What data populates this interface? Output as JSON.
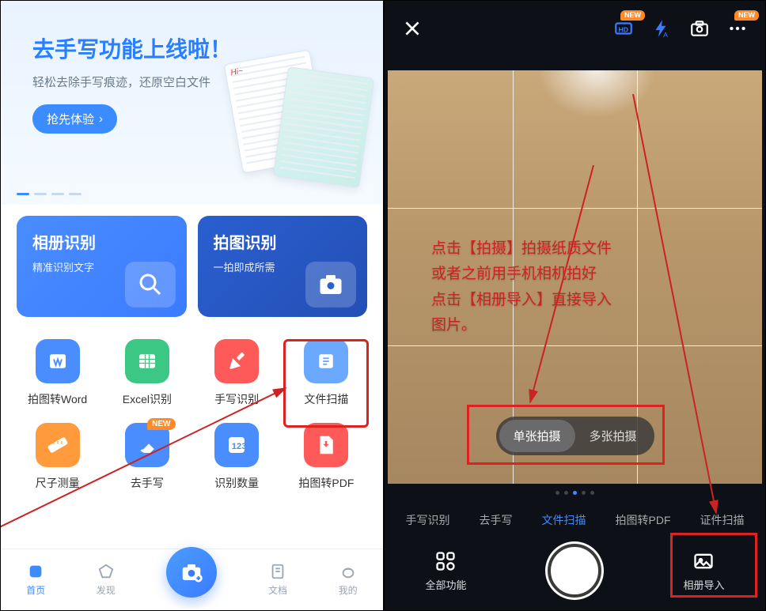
{
  "left": {
    "banner": {
      "title": "去手写功能上线啦！",
      "subtitle": "轻松去除手写痕迹，还原空白文件",
      "cta": "抢先体验"
    },
    "features": [
      {
        "title": "相册识别",
        "subtitle": "精准识别文字"
      },
      {
        "title": "拍图识别",
        "subtitle": "一拍即成所需"
      }
    ],
    "grid": [
      {
        "label": "拍图转Word",
        "icon": "word-icon",
        "color": "ic-blue"
      },
      {
        "label": "Excel识别",
        "icon": "excel-icon",
        "color": "ic-green"
      },
      {
        "label": "手写识别",
        "icon": "handwriting-icon",
        "color": "ic-red"
      },
      {
        "label": "文件扫描",
        "icon": "scan-icon",
        "color": "ic-lightblue"
      },
      {
        "label": "尺子测量",
        "icon": "ruler-icon",
        "color": "ic-orange"
      },
      {
        "label": "去手写",
        "icon": "erase-icon",
        "color": "ic-blue",
        "badge": "NEW"
      },
      {
        "label": "识别数量",
        "icon": "count-icon",
        "color": "ic-blue"
      },
      {
        "label": "拍图转PDF",
        "icon": "pdf-icon",
        "color": "ic-red"
      }
    ],
    "nav": {
      "home": "首页",
      "discover": "发现",
      "docs": "文档",
      "me": "我的"
    }
  },
  "right": {
    "badges": {
      "new": "NEW"
    },
    "instruction": "点击【拍摄】拍摄纸质文件\n或者之前用手机相机拍好\n点击【相册导入】直接导入\n图片。",
    "modes": {
      "single": "单张拍摄",
      "multi": "多张拍摄"
    },
    "tabs": [
      "手写识别",
      "去手写",
      "文件扫描",
      "拍图转PDF",
      "证件扫描"
    ],
    "active_tab": "文件扫描",
    "controls": {
      "all": "全部功能",
      "gallery": "相册导入"
    }
  }
}
